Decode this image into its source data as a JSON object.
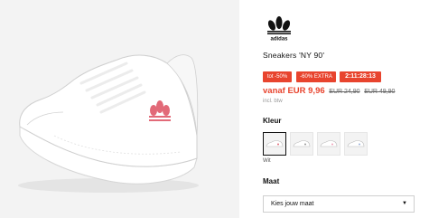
{
  "product": {
    "brand_logo_icon": "adidas-trefoil-logo",
    "title": "Sneakers 'NY 90'"
  },
  "badges": {
    "discount": "tot -50%",
    "extra": "-60% EXTRA",
    "countdown": "2:11:28:13"
  },
  "pricing": {
    "current": "vanaf EUR 9,96",
    "old_1": "EUR 24,90",
    "old_2": "EUR 49,90",
    "vat_note": "incl. btw"
  },
  "color_section": {
    "label": "Kleur",
    "selected_name": "Wit",
    "swatch_icons": [
      "white-red-sneaker-thumb",
      "white-sneaker-thumb",
      "white-pink-sneaker-thumb",
      "white-blue-sneaker-thumb"
    ]
  },
  "size_section": {
    "label": "Maat",
    "select_value": "Kies jouw maat"
  },
  "colors": {
    "sale_red": "#e8442e",
    "gallery_bg": "#f3f3f3"
  }
}
